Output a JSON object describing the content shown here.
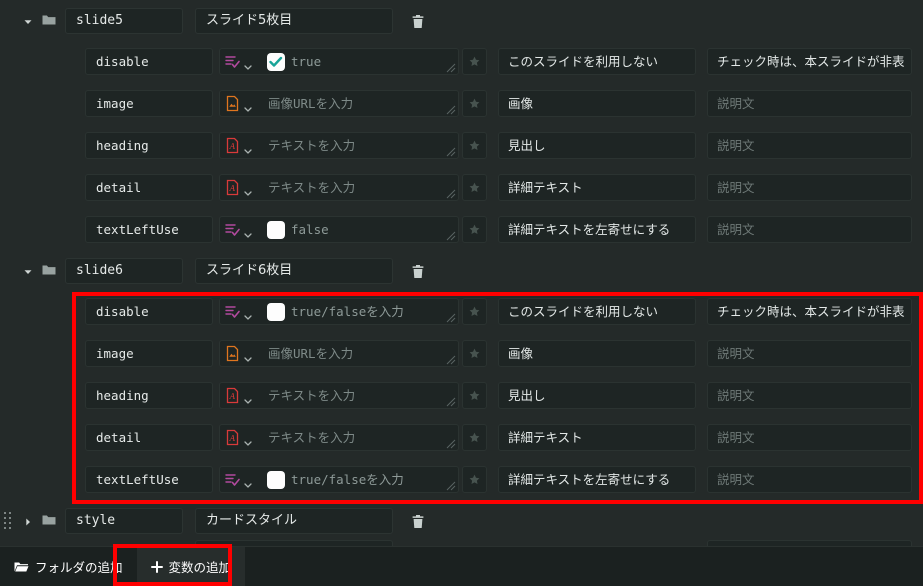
{
  "app": {
    "theme_bg": "#242a29",
    "field_bg": "#1e2524",
    "accent_highlight": "#ff0000"
  },
  "groups": [
    {
      "name": "slide5",
      "label": "スライド5枚目",
      "expanded": true,
      "caret": "caret-down-icon",
      "highlighted": false,
      "variables": [
        {
          "name": "disable",
          "type_icon": "boolean-list-icon",
          "value": "true",
          "value_placeholder": "",
          "checkbox": true,
          "checked": true,
          "title": "このスライドを利用しない",
          "title_is_placeholder": false,
          "description": "チェック時は、本スライドが非表",
          "description_is_placeholder": false
        },
        {
          "name": "image",
          "type_icon": "image-file-icon",
          "value": "",
          "value_placeholder": "画像URLを入力",
          "checkbox": false,
          "checked": false,
          "title": "画像",
          "title_is_placeholder": false,
          "description": "説明文",
          "description_is_placeholder": true
        },
        {
          "name": "heading",
          "type_icon": "text-file-icon",
          "value": "",
          "value_placeholder": "テキストを入力",
          "checkbox": false,
          "checked": false,
          "title": "見出し",
          "title_is_placeholder": false,
          "description": "説明文",
          "description_is_placeholder": true
        },
        {
          "name": "detail",
          "type_icon": "text-file-icon",
          "value": "",
          "value_placeholder": "テキストを入力",
          "checkbox": false,
          "checked": false,
          "title": "詳細テキスト",
          "title_is_placeholder": false,
          "description": "説明文",
          "description_is_placeholder": true
        },
        {
          "name": "textLeftUse",
          "type_icon": "boolean-list-icon",
          "value": "false",
          "value_placeholder": "",
          "checkbox": true,
          "checked": false,
          "title": "詳細テキストを左寄せにする",
          "title_is_placeholder": false,
          "description": "説明文",
          "description_is_placeholder": true
        }
      ]
    },
    {
      "name": "slide6",
      "label": "スライド6枚目",
      "expanded": true,
      "caret": "caret-down-icon",
      "highlighted": true,
      "variables": [
        {
          "name": "disable",
          "type_icon": "boolean-list-icon",
          "value": "",
          "value_placeholder": "true/falseを入力",
          "checkbox": true,
          "checked": false,
          "title": "このスライドを利用しない",
          "title_is_placeholder": false,
          "description": "チェック時は、本スライドが非表",
          "description_is_placeholder": false
        },
        {
          "name": "image",
          "type_icon": "image-file-icon",
          "value": "",
          "value_placeholder": "画像URLを入力",
          "checkbox": false,
          "checked": false,
          "title": "画像",
          "title_is_placeholder": false,
          "description": "説明文",
          "description_is_placeholder": true
        },
        {
          "name": "heading",
          "type_icon": "text-file-icon",
          "value": "",
          "value_placeholder": "テキストを入力",
          "checkbox": false,
          "checked": false,
          "title": "見出し",
          "title_is_placeholder": false,
          "description": "説明文",
          "description_is_placeholder": true
        },
        {
          "name": "detail",
          "type_icon": "text-file-icon",
          "value": "",
          "value_placeholder": "テキストを入力",
          "checkbox": false,
          "checked": false,
          "title": "詳細テキスト",
          "title_is_placeholder": false,
          "description": "説明文",
          "description_is_placeholder": true
        },
        {
          "name": "textLeftUse",
          "type_icon": "boolean-list-icon",
          "value": "",
          "value_placeholder": "true/falseを入力",
          "checkbox": true,
          "checked": false,
          "title": "詳細テキストを左寄せにする",
          "title_is_placeholder": false,
          "description": "説明文",
          "description_is_placeholder": true
        }
      ]
    },
    {
      "name": "style",
      "label": "カードスタイル",
      "expanded": false,
      "caret": "caret-right-icon",
      "highlighted": false,
      "variables": []
    }
  ],
  "bottom_bar": {
    "add_folder_label": "フォルダの追加",
    "add_variable_label": "変数の追加",
    "add_folder_icon": "folder-icon",
    "add_variable_icon": "plus-icon",
    "add_variable_highlighted": true
  }
}
